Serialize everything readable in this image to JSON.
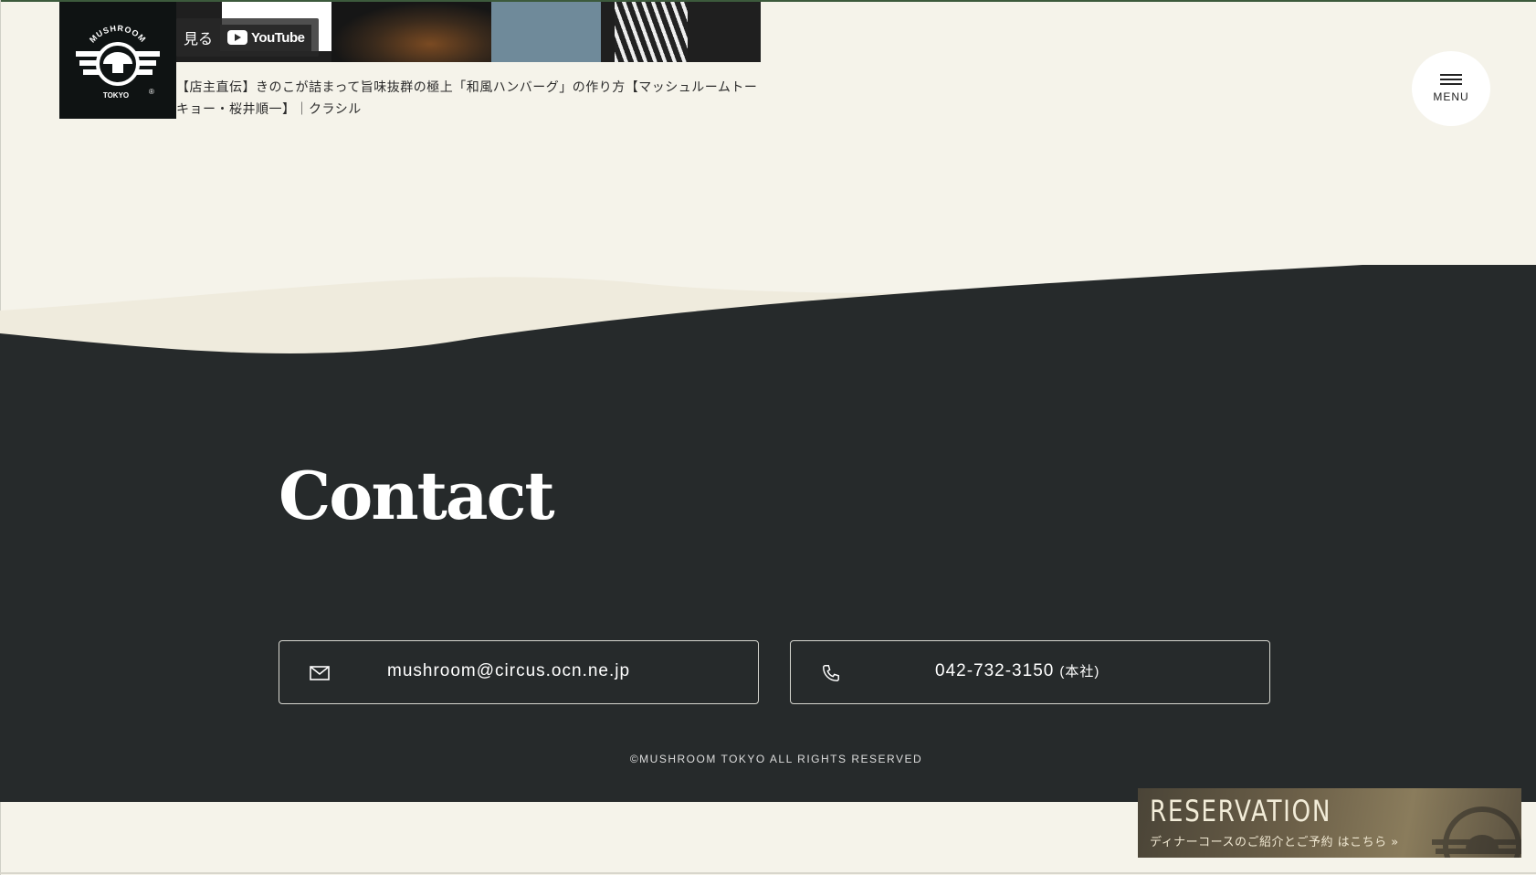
{
  "logo": {
    "top_text": "MUSHROOM",
    "bottom_text": "TOKYO",
    "mark": "®"
  },
  "video": {
    "watch_label": "見る",
    "youtube_label": "YouTube",
    "caption": "【店主直伝】きのこが詰まって旨味抜群の極上「和風ハンバーグ」の作り方【マッシュルームトーキョー・桜井順一】｜クラシル"
  },
  "menu": {
    "label": "MENU",
    "icon": "hamburger-icon"
  },
  "contact": {
    "title": "Contact",
    "email": "mushroom@circus.ocn.ne.jp",
    "phone": "042-732-3150",
    "phone_note": "(本社)"
  },
  "footer": {
    "copyright": "©MUSHROOM TOKYO ALL RIGHTS RESERVED"
  },
  "reservation": {
    "title": "RESERVATION",
    "subtitle": "ディナーコースのご紹介とご予約 はこちら »"
  },
  "colors": {
    "page_bg": "#f5f3ea",
    "dark_bg": "#262a2b",
    "logo_bg": "#0f1313",
    "reservation_gold": "#8a7c5c"
  }
}
